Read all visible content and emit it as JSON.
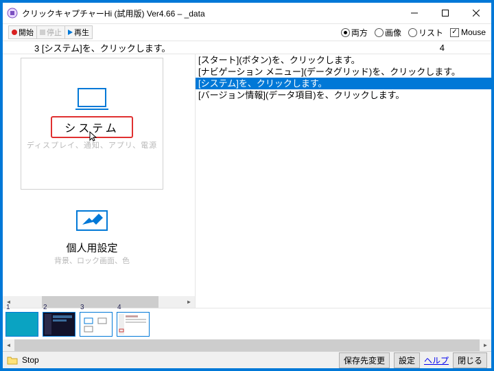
{
  "window": {
    "title": "クリックキャプチャーHi (試用版) Ver4.66  –  _data"
  },
  "toolbar": {
    "start": "開始",
    "stop": "停止",
    "play": "再生"
  },
  "viewopts": {
    "both": "両方",
    "image": "画像",
    "list": "リスト",
    "mouse": "Mouse"
  },
  "header": {
    "idx": "3",
    "desc": "[システム]を、クリックします。",
    "count": "4"
  },
  "tile_system": {
    "title": "システム",
    "sub": "ディスプレイ、通知、アプリ、電源"
  },
  "tile_personal": {
    "title": "個人用設定",
    "sub": "背景、ロック画面、色"
  },
  "steps": [
    "[スタート](ボタン)を、クリックします。",
    "[ナビゲーション メニュー](データグリッド)を、クリックします。",
    "[システム]を、クリックします。",
    "[バージョン情報](データ項目)を、クリックします。"
  ],
  "thumbs": [
    "1",
    "2",
    "3",
    "4"
  ],
  "status": {
    "state": "Stop",
    "savedest": "保存先変更",
    "settings": "設定",
    "help": "ヘルプ",
    "close": "閉じる"
  }
}
